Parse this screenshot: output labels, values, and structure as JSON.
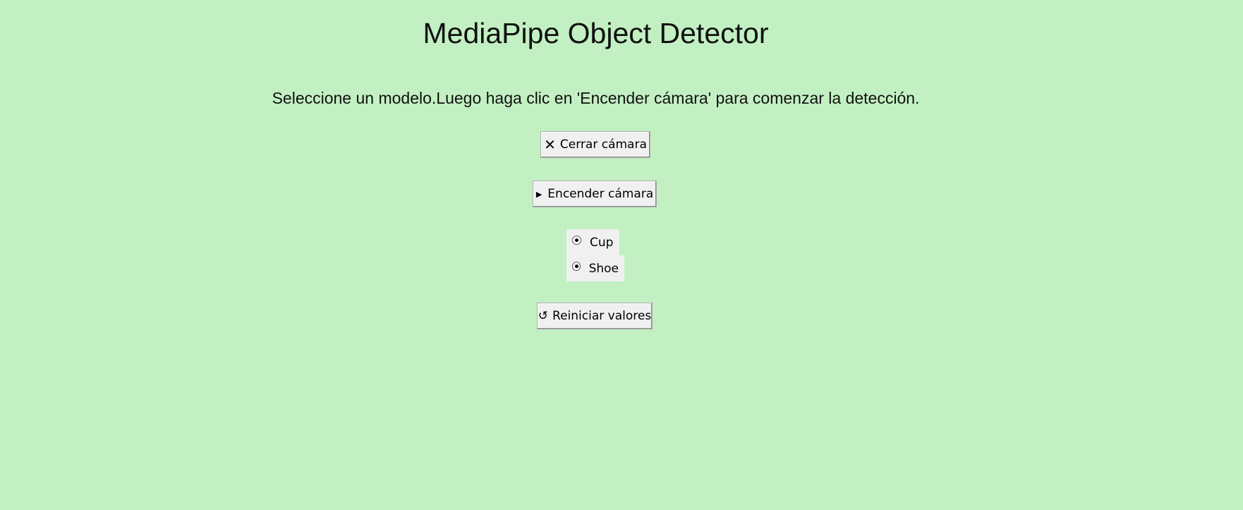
{
  "header": {
    "title": "MediaPipe Object Detector",
    "instructions": "Seleccione un modelo.Luego haga clic en 'Encender cámara' para comenzar la detección."
  },
  "buttons": {
    "close_camera": {
      "icon": "close-icon",
      "label": "Cerrar cámara"
    },
    "start_camera": {
      "icon": "play-icon",
      "label": "Encender cámara"
    },
    "reset": {
      "icon": "refresh-icon",
      "label": "Reiniciar valores"
    }
  },
  "models": [
    {
      "label": "Cup",
      "selected": true
    },
    {
      "label": "Shoe",
      "selected": true
    }
  ],
  "colors": {
    "background": "#c2f0c2",
    "control_background": "#f0f0f0"
  }
}
